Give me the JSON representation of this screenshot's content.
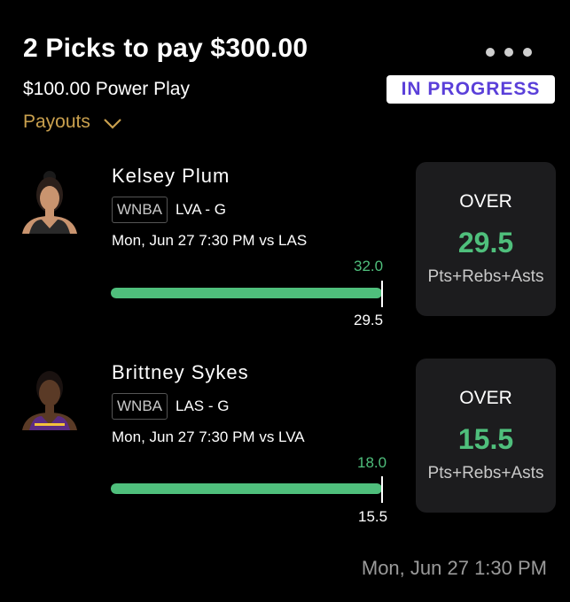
{
  "header": {
    "title": "2 Picks to pay $300.00",
    "subtitle": "$100.00 Power Play",
    "status": "IN PROGRESS",
    "payouts_label": "Payouts",
    "menu_icon": "more-horizontal-icon",
    "payouts_icon": "chevron-down-icon"
  },
  "colors": {
    "accent_green": "#4fbf7c",
    "status_purple": "#5a3fd9",
    "payouts_gold": "#c9a04e",
    "card_bg": "#1c1c1e"
  },
  "picks": [
    {
      "name": "Kelsey Plum",
      "league": "WNBA",
      "team_pos": "LVA - G",
      "game": "Mon, Jun 27 7:30 PM  vs LAS",
      "actual": "32.0",
      "line": "29.5",
      "direction": "OVER",
      "stat": "Pts+Rebs+Asts",
      "jersey_color": "#2a2a2a"
    },
    {
      "name": "Brittney Sykes",
      "league": "WNBA",
      "team_pos": "LAS - G",
      "game": "Mon, Jun 27 7:30 PM  vs LVA",
      "actual": "18.0",
      "line": "15.5",
      "direction": "OVER",
      "stat": "Pts+Rebs+Asts",
      "jersey_color": "#5b2c83"
    }
  ],
  "footer": {
    "timestamp": "Mon, Jun 27 1:30 PM"
  }
}
